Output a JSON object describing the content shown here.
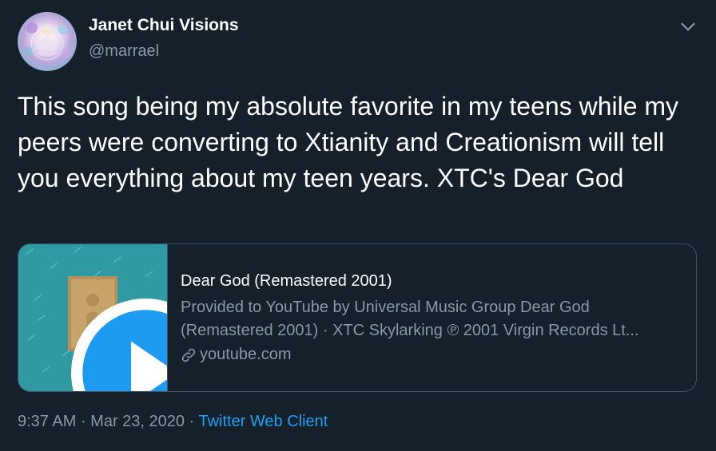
{
  "author": {
    "display_name": "Janet Chui Visions",
    "handle": "@marrael",
    "avatar_icon": "meditating-figure-avatar"
  },
  "tweet": {
    "text": "This song being my absolute favorite in my teens while my peers were converting to Xtianity and Creationism will tell you everything about my teen years. XTC's Dear God"
  },
  "card": {
    "title": "Dear God (Remastered 2001)",
    "description": "Provided to YouTube by Universal Music Group Dear God (Remastered 2001) · XTC Skylarking ℗ 2001 Virgin Records Lt...",
    "domain": "youtube.com",
    "thumbnail_icon": "album-cover-skylarking",
    "play_icon": "play-icon",
    "link_icon": "link-icon"
  },
  "meta": {
    "time": "9:37 AM",
    "separator": " · ",
    "date": "Mar 23, 2020",
    "source": "Twitter Web Client"
  },
  "colors": {
    "background": "#15202b",
    "primary_text": "#ffffff",
    "secondary_text": "#8899a6",
    "accent": "#1da1f2",
    "border": "#3d5466",
    "thumbnail_bg": "#2f9aa2"
  }
}
